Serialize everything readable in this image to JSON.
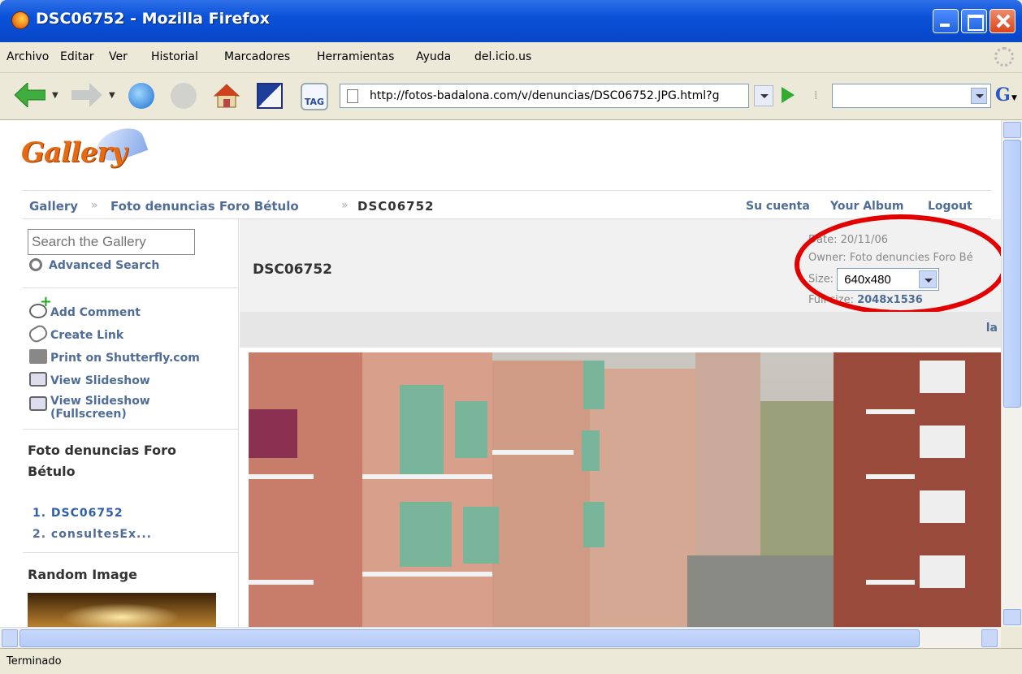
{
  "window": {
    "title": "DSC06752 - Mozilla Firefox"
  },
  "menu": [
    "Archivo",
    "Editar",
    "Ver",
    "Historial",
    "Marcadores",
    "Herramientas",
    "Ayuda",
    "del.icio.us"
  ],
  "toolbar": {
    "tag_label": "TAG",
    "url": "http://fotos-badalona.com/v/denuncias/DSC06752.JPG.html?g",
    "search_value": ""
  },
  "gallery": {
    "logo": "Gallery",
    "breadcrumb": [
      "Gallery",
      "Foto denuncias Foro Bétulo",
      "DSC06752"
    ],
    "breadcrumb_sep": "»",
    "top_links": [
      "Su cuenta",
      "Your Album",
      "Logout"
    ],
    "search_placeholder": "Search the Gallery",
    "advanced_search": "Advanced Search",
    "actions": [
      "Add Comment",
      "Create Link",
      "Print on Shutterfly.com",
      "View Slideshow",
      "View Slideshow (Fullscreen)"
    ],
    "album_title": "Foto denuncias Foro Bétulo",
    "album_items": [
      "1. DSC06752",
      "2. consultesEx..."
    ],
    "random_title": "Random Image",
    "photo_title": "DSC06752",
    "meta": {
      "date_label": "Date:",
      "date": "20/11/06",
      "owner_label": "Owner:",
      "owner": "Foto denuncies Foro Bé",
      "size_label": "Size:",
      "size": "640x480",
      "fullsize_label": "Full size:",
      "fullsize": "2048x1536"
    },
    "nav_text": "la"
  },
  "status": {
    "text": "Terminado"
  },
  "colors": {
    "link": "#4f6d97",
    "highlight": "#e20000",
    "title_bar": "#0a52d8"
  }
}
